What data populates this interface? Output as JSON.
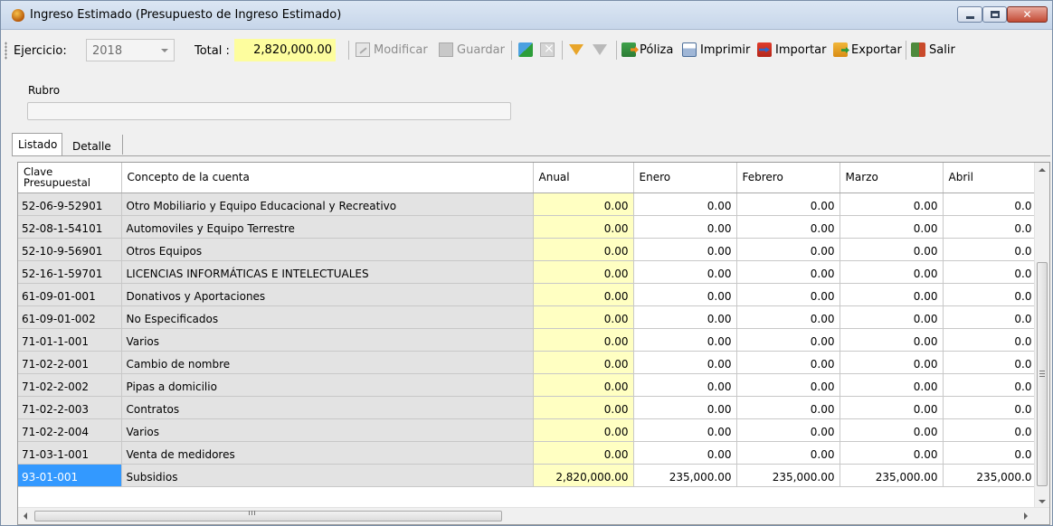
{
  "window": {
    "title": "Ingreso Estimado (Presupuesto de Ingreso Estimado)",
    "controls": {
      "minimize": "minimize-icon",
      "maximize": "maximize-icon",
      "close": "close-icon"
    }
  },
  "toolbar": {
    "ejercicio_label": "Ejercicio:",
    "ejercicio_value": "2018",
    "total_label": "Total :",
    "total_value": "2,820,000.00",
    "modificar_label": "Modificar",
    "guardar_label": "Guardar",
    "poliza_label": "Póliza",
    "imprimir_label": "Imprimir",
    "importar_label": "Importar",
    "exportar_label": "Exportar",
    "salir_label": "Salir"
  },
  "rubro": {
    "label": "Rubro",
    "value": ""
  },
  "tabs": [
    {
      "label": "Listado",
      "active": true
    },
    {
      "label": "Detalle",
      "active": false
    }
  ],
  "grid": {
    "columns": [
      "Clave Presupuestal",
      "Concepto de la cuenta",
      "Anual",
      "Enero",
      "Febrero",
      "Marzo",
      "Abril"
    ],
    "clave_header_line1": "Clave",
    "clave_header_line2": "Presupuestal",
    "rows": [
      {
        "clave": "52-06-9-52901",
        "concepto": "Otro Mobiliario y Equipo Educacional y Recreativo",
        "anual": "0.00",
        "enero": "0.00",
        "febrero": "0.00",
        "marzo": "0.00",
        "abril": "0.0"
      },
      {
        "clave": "52-08-1-54101",
        "concepto": "Automoviles y Equipo Terrestre",
        "anual": "0.00",
        "enero": "0.00",
        "febrero": "0.00",
        "marzo": "0.00",
        "abril": "0.0"
      },
      {
        "clave": "52-10-9-56901",
        "concepto": "Otros Equipos",
        "anual": "0.00",
        "enero": "0.00",
        "febrero": "0.00",
        "marzo": "0.00",
        "abril": "0.0"
      },
      {
        "clave": "52-16-1-59701",
        "concepto": "LICENCIAS INFORMÁTICAS E INTELECTUALES",
        "anual": "0.00",
        "enero": "0.00",
        "febrero": "0.00",
        "marzo": "0.00",
        "abril": "0.0"
      },
      {
        "clave": "61-09-01-001",
        "concepto": "Donativos y Aportaciones",
        "anual": "0.00",
        "enero": "0.00",
        "febrero": "0.00",
        "marzo": "0.00",
        "abril": "0.0"
      },
      {
        "clave": "61-09-01-002",
        "concepto": "No Especificados",
        "anual": "0.00",
        "enero": "0.00",
        "febrero": "0.00",
        "marzo": "0.00",
        "abril": "0.0"
      },
      {
        "clave": "71-01-1-001",
        "concepto": "Varios",
        "anual": "0.00",
        "enero": "0.00",
        "febrero": "0.00",
        "marzo": "0.00",
        "abril": "0.0"
      },
      {
        "clave": "71-02-2-001",
        "concepto": "Cambio de nombre",
        "anual": "0.00",
        "enero": "0.00",
        "febrero": "0.00",
        "marzo": "0.00",
        "abril": "0.0"
      },
      {
        "clave": "71-02-2-002",
        "concepto": "Pipas a domicilio",
        "anual": "0.00",
        "enero": "0.00",
        "febrero": "0.00",
        "marzo": "0.00",
        "abril": "0.0"
      },
      {
        "clave": "71-02-2-003",
        "concepto": "Contratos",
        "anual": "0.00",
        "enero": "0.00",
        "febrero": "0.00",
        "marzo": "0.00",
        "abril": "0.0"
      },
      {
        "clave": "71-02-2-004",
        "concepto": "Varios",
        "anual": "0.00",
        "enero": "0.00",
        "febrero": "0.00",
        "marzo": "0.00",
        "abril": "0.0"
      },
      {
        "clave": "71-03-1-001",
        "concepto": "Venta de medidores",
        "anual": "0.00",
        "enero": "0.00",
        "febrero": "0.00",
        "marzo": "0.00",
        "abril": "0.0"
      },
      {
        "clave": "93-01-001",
        "concepto": "Subsidios",
        "anual": "2,820,000.00",
        "enero": "235,000.00",
        "febrero": "235,000.00",
        "marzo": "235,000.00",
        "abril": "235,000.0"
      }
    ],
    "selected_row": 12,
    "hscroll_grip": "III"
  },
  "colors": {
    "highlight_yellow": "#fdfd9e",
    "anual_column": "#ffffc2",
    "selected_blue": "#3399ff",
    "locked_gray": "#e3e3e3"
  }
}
